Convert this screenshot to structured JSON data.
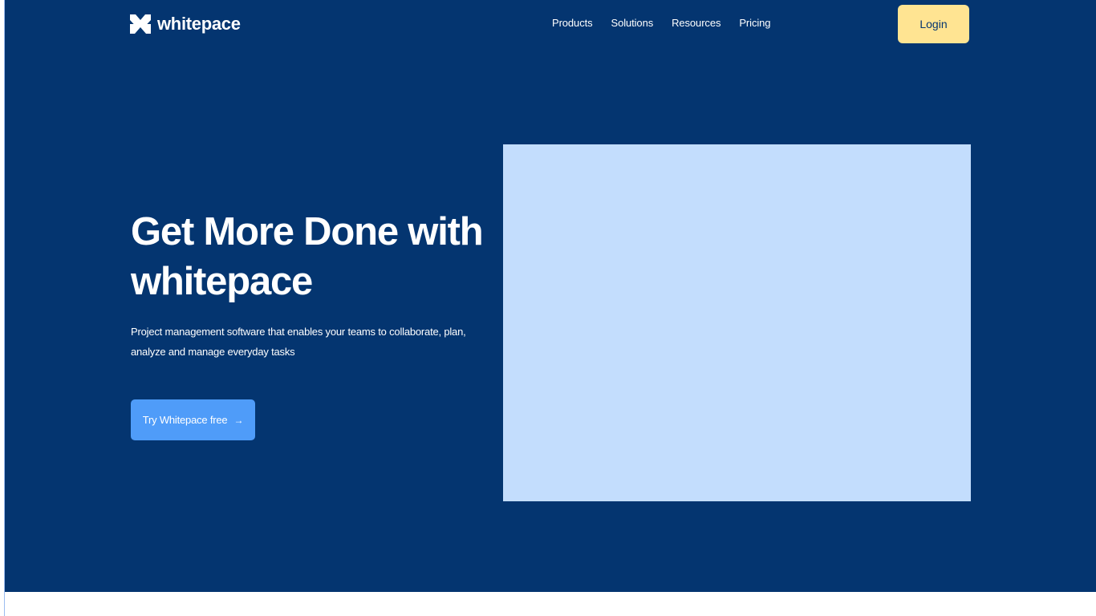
{
  "brand": {
    "name": "whitepace",
    "logo_icon": "whitepace-logo-icon"
  },
  "nav": {
    "items": [
      {
        "label": "Products"
      },
      {
        "label": "Solutions"
      },
      {
        "label": "Resources"
      },
      {
        "label": "Pricing"
      }
    ],
    "login_label": "Login"
  },
  "hero": {
    "title": "Get More Done with whitepace",
    "subtitle": "Project management software that enables your teams to collaborate, plan, analyze and manage everyday tasks",
    "cta_label": "Try Whitepace free",
    "cta_icon": "arrow-right-icon"
  },
  "colors": {
    "hero_background": "#043570",
    "login_button": "#ffe492",
    "cta_button": "#4f9cf9",
    "image_placeholder": "#c3ddfd",
    "text_light": "#ffffff"
  }
}
